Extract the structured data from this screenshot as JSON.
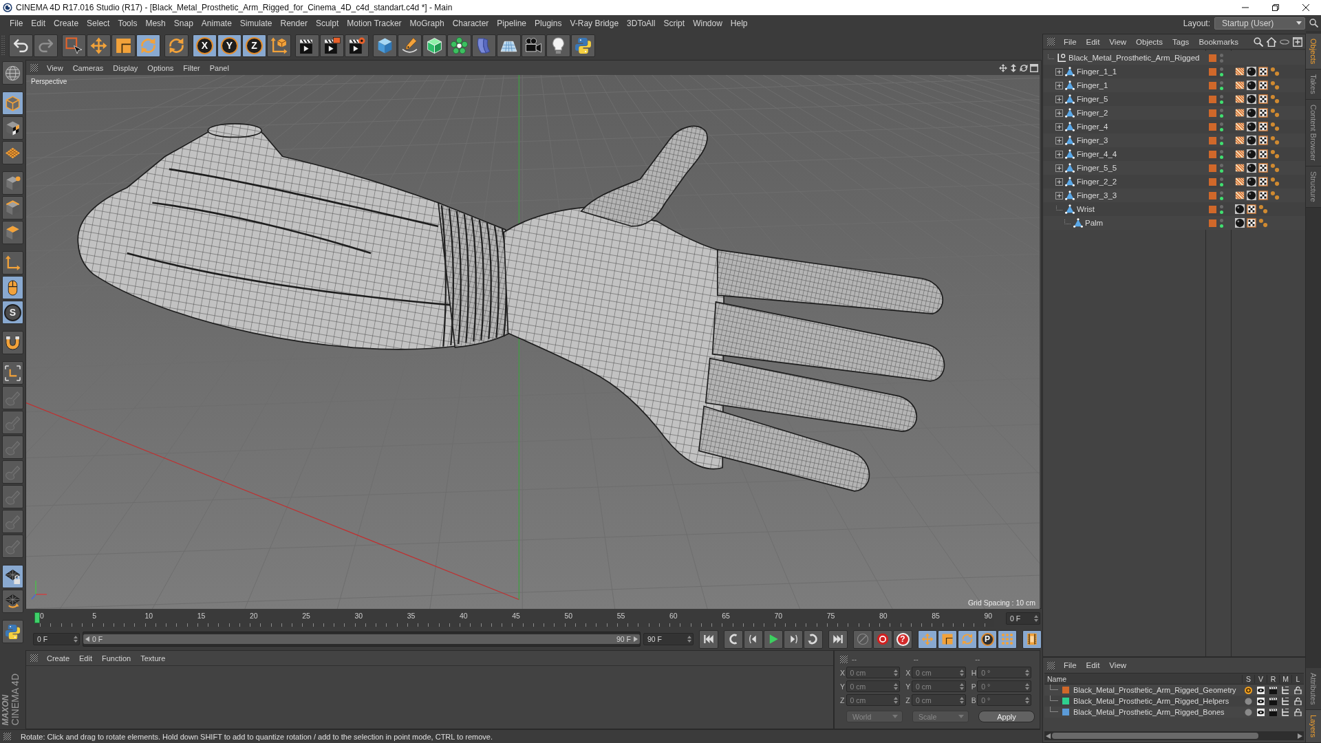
{
  "window": {
    "title": "CINEMA 4D R17.016 Studio (R17) - [Black_Metal_Prosthetic_Arm_Rigged_for_Cinema_4D_c4d_standart.c4d *] - Main"
  },
  "menu_bar": {
    "items": [
      "File",
      "Edit",
      "Create",
      "Select",
      "Tools",
      "Mesh",
      "Snap",
      "Animate",
      "Simulate",
      "Render",
      "Sculpt",
      "Motion Tracker",
      "MoGraph",
      "Character",
      "Pipeline",
      "Plugins",
      "V-Ray Bridge",
      "3DToAll",
      "Script",
      "Window",
      "Help"
    ],
    "layout_label": "Layout:",
    "layout_value": "Startup (User)"
  },
  "toolbar": {
    "groups": [
      [
        {
          "kind": "undo",
          "selected": false,
          "disabled": false
        },
        {
          "kind": "redo",
          "selected": false,
          "disabled": true
        }
      ],
      [
        {
          "kind": "select",
          "selected": false,
          "disabled": false
        },
        {
          "kind": "move",
          "selected": false,
          "disabled": false
        },
        {
          "kind": "scale",
          "selected": false,
          "disabled": false
        },
        {
          "kind": "rotate",
          "selected": true,
          "disabled": false
        }
      ],
      [
        {
          "kind": "recent",
          "selected": false,
          "disabled": false
        }
      ],
      [
        {
          "kind": "axis",
          "label": "X",
          "selected": true,
          "disabled": false
        },
        {
          "kind": "axis",
          "label": "Y",
          "selected": true,
          "disabled": false
        },
        {
          "kind": "axis",
          "label": "Z",
          "selected": true,
          "disabled": false
        },
        {
          "kind": "coords",
          "selected": false,
          "disabled": false
        }
      ],
      [
        {
          "kind": "renderview",
          "selected": false,
          "disabled": false
        },
        {
          "kind": "pictureviewer",
          "selected": false,
          "disabled": false
        },
        {
          "kind": "rendersettings",
          "selected": false,
          "disabled": false
        }
      ],
      [
        {
          "kind": "cube",
          "selected": false,
          "disabled": false
        },
        {
          "kind": "pen",
          "selected": false,
          "disabled": false
        },
        {
          "kind": "subdivide",
          "selected": false,
          "disabled": false
        },
        {
          "kind": "cloner",
          "selected": false,
          "disabled": false
        },
        {
          "kind": "deformer",
          "selected": false,
          "disabled": false
        },
        {
          "kind": "floor",
          "selected": false,
          "disabled": false
        },
        {
          "kind": "camera",
          "selected": false,
          "disabled": false
        },
        {
          "kind": "light",
          "selected": false,
          "disabled": false
        },
        {
          "kind": "python",
          "selected": false,
          "disabled": false
        }
      ]
    ]
  },
  "left_toolbar": {
    "groups": [
      [
        {
          "kind": "globe",
          "selected": false,
          "disabled": false
        }
      ],
      [
        {
          "kind": "model",
          "selected": true,
          "disabled": false
        },
        {
          "kind": "texture",
          "selected": false,
          "disabled": false
        },
        {
          "kind": "workplane",
          "selected": false,
          "disabled": false
        }
      ],
      [
        {
          "kind": "points",
          "selected": false,
          "disabled": false
        },
        {
          "kind": "edges",
          "selected": false,
          "disabled": false
        },
        {
          "kind": "polygons",
          "selected": false,
          "disabled": false
        }
      ],
      [
        {
          "kind": "axes",
          "selected": false,
          "disabled": false
        },
        {
          "kind": "tweak",
          "selected": true,
          "disabled": false
        },
        {
          "kind": "solo",
          "label": "S",
          "selected": true,
          "disabled": false
        }
      ],
      [
        {
          "kind": "magnet",
          "selected": false,
          "disabled": false
        }
      ],
      [
        {
          "kind": "corners",
          "selected": false,
          "disabled": false
        },
        {
          "kind": "key",
          "selected": false,
          "disabled": true
        },
        {
          "kind": "key",
          "selected": false,
          "disabled": true
        },
        {
          "kind": "key",
          "selected": false,
          "disabled": true
        },
        {
          "kind": "key",
          "selected": false,
          "disabled": true
        },
        {
          "kind": "key",
          "selected": false,
          "disabled": true
        },
        {
          "kind": "key",
          "selected": false,
          "disabled": true
        },
        {
          "kind": "key",
          "selected": false,
          "disabled": true
        }
      ],
      [
        {
          "kind": "gridlock",
          "selected": true,
          "disabled": false
        },
        {
          "kind": "gridrotate",
          "selected": false,
          "disabled": false
        }
      ],
      [
        {
          "kind": "python",
          "selected": false,
          "disabled": false
        }
      ]
    ]
  },
  "viewport": {
    "menu": [
      "View",
      "Cameras",
      "Display",
      "Options",
      "Filter",
      "Panel"
    ],
    "camera": "Perspective",
    "grid_spacing": "Grid Spacing : 10 cm"
  },
  "timeline": {
    "ticks": [
      "0",
      "5",
      "10",
      "15",
      "20",
      "25",
      "30",
      "35",
      "40",
      "45",
      "50",
      "55",
      "60",
      "65",
      "70",
      "75",
      "80",
      "85",
      "90"
    ],
    "playhead": {
      "level": 0
    },
    "current_frame": "0 F"
  },
  "transport": {
    "start_frame": "0 F",
    "range": {
      "start": "0 F",
      "end": "90 F",
      "level": 1
    },
    "end_frame": "90 F",
    "groups": [
      [
        {
          "kind": "first",
          "selected": false
        }
      ],
      [
        {
          "kind": "prevkey",
          "selected": false
        },
        {
          "kind": "prevframe",
          "selected": false
        },
        {
          "kind": "play",
          "selected": false
        },
        {
          "kind": "nextframe",
          "selected": false
        },
        {
          "kind": "nextkey",
          "selected": false
        }
      ],
      [
        {
          "kind": "last",
          "selected": false
        }
      ],
      [
        {
          "kind": "recordoff",
          "selected": false
        },
        {
          "kind": "record",
          "selected": false
        },
        {
          "kind": "autokey",
          "label": "?",
          "selected": false
        }
      ],
      [
        {
          "kind": "keymove",
          "selected": true
        },
        {
          "kind": "keyscale",
          "selected": true
        },
        {
          "kind": "keyrotate",
          "selected": true
        },
        {
          "kind": "param",
          "label": "P",
          "selected": true
        },
        {
          "kind": "pla",
          "selected": true
        }
      ],
      [
        {
          "kind": "film",
          "selected": true
        }
      ]
    ]
  },
  "material_manager": {
    "menu": [
      "Create",
      "Edit",
      "Function",
      "Texture"
    ]
  },
  "coordinates": {
    "headers": [
      "--",
      "--",
      "--"
    ],
    "rows": [
      {
        "position_axis": "X",
        "position": "0 cm",
        "size_axis": "X",
        "size": "0 cm",
        "rotation_axis": "H",
        "rotation": "0 °"
      },
      {
        "position_axis": "Y",
        "position": "0 cm",
        "size_axis": "Y",
        "size": "0 cm",
        "rotation_axis": "P",
        "rotation": "0 °"
      },
      {
        "position_axis": "Z",
        "position": "0 cm",
        "size_axis": "Z",
        "size": "0 cm",
        "rotation_axis": "B",
        "rotation": "0 °"
      }
    ],
    "mode": {
      "value": "World",
      "disabled": true
    },
    "type": {
      "value": "Scale",
      "disabled": true
    },
    "apply": "Apply"
  },
  "status_bar": {
    "text": "Rotate: Click and drag to rotate elements. Hold down SHIFT to add to quantize rotation / add to the selection in point mode, CTRL to remove."
  },
  "object_manager": {
    "menu": [
      "File",
      "Edit",
      "View",
      "Objects",
      "Tags",
      "Bookmarks"
    ],
    "objects": [
      {
        "name": "Black_Metal_Prosthetic_Arm_Rigged",
        "kind": "null",
        "collapsed": false,
        "color": "#d0682a",
        "render_on": false,
        "children": [
          {
            "name": "Finger_1_1",
            "kind": "joint",
            "collapsed": true,
            "color": "#d0682a",
            "render_on": true,
            "tags": [
              {
                "kind": "weight"
              },
              {
                "kind": "material"
              },
              {
                "kind": "texture"
              },
              {
                "kind": "points"
              }
            ]
          },
          {
            "name": "Finger_1",
            "kind": "joint",
            "collapsed": true,
            "color": "#d0682a",
            "render_on": true,
            "tags": [
              {
                "kind": "weight"
              },
              {
                "kind": "material"
              },
              {
                "kind": "texture"
              },
              {
                "kind": "points"
              }
            ]
          },
          {
            "name": "Finger_5",
            "kind": "joint",
            "collapsed": true,
            "color": "#d0682a",
            "render_on": true,
            "tags": [
              {
                "kind": "weight"
              },
              {
                "kind": "material"
              },
              {
                "kind": "texture"
              },
              {
                "kind": "points"
              }
            ]
          },
          {
            "name": "Finger_2",
            "kind": "joint",
            "collapsed": true,
            "color": "#d0682a",
            "render_on": true,
            "tags": [
              {
                "kind": "weight"
              },
              {
                "kind": "material"
              },
              {
                "kind": "texture"
              },
              {
                "kind": "points"
              }
            ]
          },
          {
            "name": "Finger_4",
            "kind": "joint",
            "collapsed": true,
            "color": "#d0682a",
            "render_on": true,
            "tags": [
              {
                "kind": "weight"
              },
              {
                "kind": "material"
              },
              {
                "kind": "texture"
              },
              {
                "kind": "points"
              }
            ]
          },
          {
            "name": "Finger_3",
            "kind": "joint",
            "collapsed": true,
            "color": "#d0682a",
            "render_on": true,
            "tags": [
              {
                "kind": "weight"
              },
              {
                "kind": "material"
              },
              {
                "kind": "texture"
              },
              {
                "kind": "points"
              }
            ]
          },
          {
            "name": "Finger_4_4",
            "kind": "joint",
            "collapsed": true,
            "color": "#d0682a",
            "render_on": true,
            "tags": [
              {
                "kind": "weight"
              },
              {
                "kind": "material"
              },
              {
                "kind": "texture"
              },
              {
                "kind": "points"
              }
            ]
          },
          {
            "name": "Finger_5_5",
            "kind": "joint",
            "collapsed": true,
            "color": "#d0682a",
            "render_on": true,
            "tags": [
              {
                "kind": "weight"
              },
              {
                "kind": "material"
              },
              {
                "kind": "texture"
              },
              {
                "kind": "points"
              }
            ]
          },
          {
            "name": "Finger_2_2",
            "kind": "joint",
            "collapsed": true,
            "color": "#d0682a",
            "render_on": true,
            "tags": [
              {
                "kind": "weight"
              },
              {
                "kind": "material"
              },
              {
                "kind": "texture"
              },
              {
                "kind": "points"
              }
            ]
          },
          {
            "name": "Finger_3_3",
            "kind": "joint",
            "collapsed": true,
            "color": "#d0682a",
            "render_on": true,
            "tags": [
              {
                "kind": "weight"
              },
              {
                "kind": "material"
              },
              {
                "kind": "texture"
              },
              {
                "kind": "points"
              }
            ]
          },
          {
            "name": "Wrist",
            "kind": "joint",
            "collapsed": false,
            "color": "#d0682a",
            "render_on": true,
            "tags": [
              {
                "kind": "material"
              },
              {
                "kind": "texture"
              },
              {
                "kind": "points"
              }
            ],
            "children": [
              {
                "name": "Palm",
                "kind": "joint",
                "collapsed": false,
                "color": "#d0682a",
                "render_on": true,
                "tags": [
                  {
                    "kind": "material"
                  },
                  {
                    "kind": "texture"
                  },
                  {
                    "kind": "points"
                  }
                ]
              }
            ]
          }
        ]
      }
    ]
  },
  "layer_manager": {
    "menu": [
      "File",
      "Edit",
      "View"
    ],
    "columns": [
      "Name",
      "S",
      "V",
      "R",
      "M",
      "L"
    ],
    "layers": [
      {
        "name": "Black_Metal_Prosthetic_Arm_Rigged_Geometry",
        "color": "#d0682a",
        "solo": true
      },
      {
        "name": "Black_Metal_Prosthetic_Arm_Rigged_Helpers",
        "color": "#2ed08e",
        "solo": false
      },
      {
        "name": "Black_Metal_Prosthetic_Arm_Rigged_Bones",
        "color": "#5b9bd8",
        "solo": false
      }
    ]
  },
  "side_tabs": {
    "top": [
      {
        "label": "Objects",
        "selected": true
      },
      {
        "label": "Takes",
        "selected": false
      },
      {
        "label": "Content Browser",
        "selected": false
      },
      {
        "label": "Structure",
        "selected": false
      }
    ],
    "bottom": [
      {
        "label": "Attributes",
        "selected": false
      },
      {
        "label": "Layers",
        "selected": true
      }
    ]
  },
  "brand": {
    "company": "MAXON",
    "product": "CINEMA 4D"
  }
}
